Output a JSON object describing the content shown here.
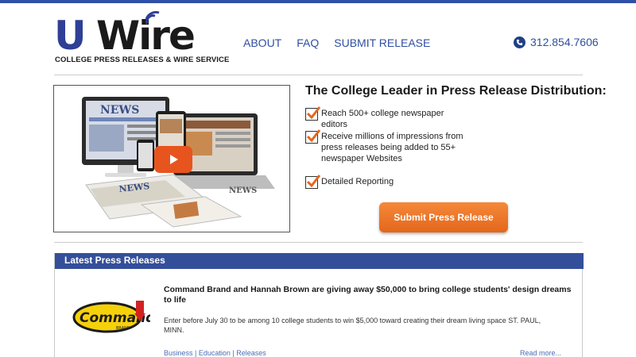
{
  "header": {
    "logo_u": "U",
    "logo_wire": "Wire",
    "tagline": "COLLEGE PRESS RELEASES & WIRE SERVICE",
    "nav": [
      {
        "label": "ABOUT"
      },
      {
        "label": "FAQ"
      },
      {
        "label": "SUBMIT RELEASE"
      }
    ],
    "phone": "312.854.7606"
  },
  "hero": {
    "title": "The College Leader in Press Release Distribution:",
    "features": [
      {
        "text": "Reach 500+ college newspaper editors"
      },
      {
        "text": "Receive millions of impressions from press releases being added to 55+ newspaper Websites"
      },
      {
        "text": "Detailed Reporting"
      }
    ],
    "cta_label": "Submit Press Release",
    "video_label": "NEWS"
  },
  "latest": {
    "heading": "Latest Press Releases",
    "items": [
      {
        "logo_text": "Command",
        "logo_sub": "BRAND",
        "title": "Command Brand and Hannah Brown are giving away $50,000 to bring college students' design dreams to life",
        "description": "Enter before July 30 to be among 10 college students to win $5,000 toward creating their dream living space ST. PAUL, MINN.",
        "tags": [
          "Business",
          "Education",
          "Releases"
        ],
        "tag_sep": " | ",
        "read_more": "Read more..."
      }
    ]
  },
  "colors": {
    "brand_blue": "#2f50a8",
    "header_bar": "#344f9a",
    "cta_orange": "#e4661b",
    "link_blue": "#4a6db5"
  }
}
